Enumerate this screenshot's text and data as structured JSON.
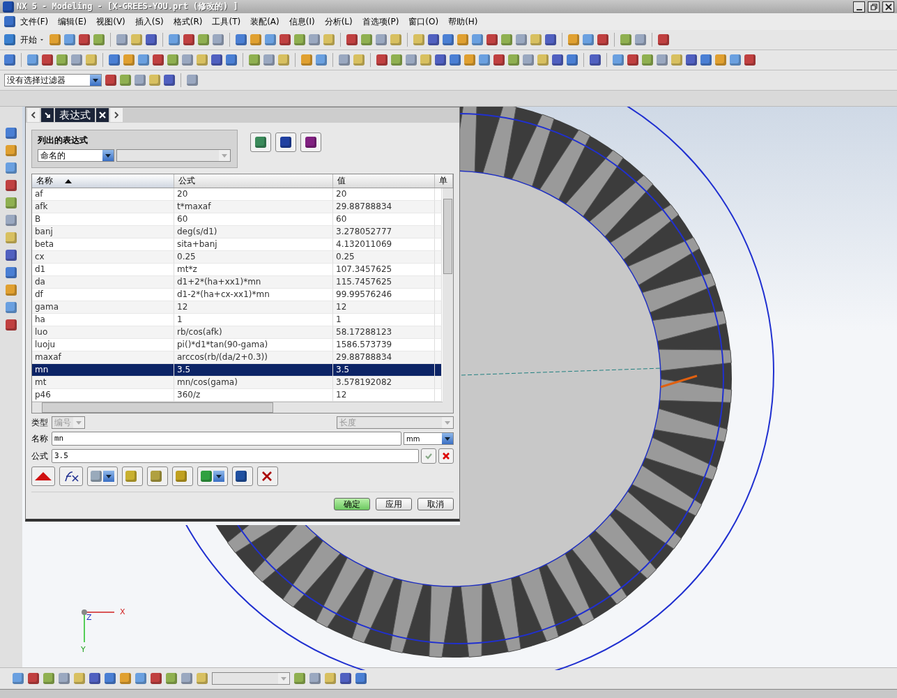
{
  "window": {
    "title": "NX 5 - Modeling - [X-GREES-YOU.prt (修改的) ]"
  },
  "menu": [
    "文件(F)",
    "编辑(E)",
    "视图(V)",
    "插入(S)",
    "格式(R)",
    "工具(T)",
    "装配(A)",
    "信息(I)",
    "分析(L)",
    "首选项(P)",
    "窗口(O)",
    "帮助(H)"
  ],
  "toolbar": {
    "start_button": "开始"
  },
  "selection_filter": {
    "value": "没有选择过滤器"
  },
  "dialog": {
    "title": "表达式",
    "listed_group": {
      "label": "列出的表达式",
      "filter": "命名的"
    },
    "table": {
      "columns": [
        {
          "label": "名称",
          "sorted": true
        },
        {
          "label": "公式",
          "sorted": false
        },
        {
          "label": "值",
          "sorted": false
        },
        {
          "label": "单",
          "sorted": false
        }
      ],
      "rows": [
        {
          "name": "af",
          "formula": "20",
          "value": "20",
          "selected": false
        },
        {
          "name": "afk",
          "formula": "t*maxaf",
          "value": "29.88788834",
          "selected": false
        },
        {
          "name": "B",
          "formula": "60",
          "value": "60",
          "selected": false
        },
        {
          "name": "banj",
          "formula": "deg(s/d1)",
          "value": "3.278052777",
          "selected": false
        },
        {
          "name": "beta",
          "formula": "sita+banj",
          "value": "4.132011069",
          "selected": false
        },
        {
          "name": "cx",
          "formula": "0.25",
          "value": "0.25",
          "selected": false
        },
        {
          "name": "d1",
          "formula": "mt*z",
          "value": "107.3457625",
          "selected": false
        },
        {
          "name": "da",
          "formula": "d1+2*(ha+xx1)*mn",
          "value": "115.7457625",
          "selected": false
        },
        {
          "name": "df",
          "formula": "d1-2*(ha+cx-xx1)*mn",
          "value": "99.99576246",
          "selected": false
        },
        {
          "name": "gama",
          "formula": "12",
          "value": "12",
          "selected": false
        },
        {
          "name": "ha",
          "formula": "1",
          "value": "1",
          "selected": false
        },
        {
          "name": "luo",
          "formula": "rb/cos(afk)",
          "value": "58.17288123",
          "selected": false
        },
        {
          "name": "luoju",
          "formula": "pi()*d1*tan(90-gama)",
          "value": "1586.573739",
          "selected": false
        },
        {
          "name": "maxaf",
          "formula": "arccos(rb/(da/2+0.3))",
          "value": "29.88788834",
          "selected": false
        },
        {
          "name": "mn",
          "formula": "3.5",
          "value": "3.5",
          "selected": true
        },
        {
          "name": "mt",
          "formula": "mn/cos(gama)",
          "value": "3.578192082",
          "selected": false
        },
        {
          "name": "p46",
          "formula": "360/z",
          "value": "12",
          "selected": false
        }
      ]
    },
    "form": {
      "type_label": "类型",
      "type_value": "编号",
      "type_disabled": true,
      "dimension_value": "长度",
      "dimension_disabled": true,
      "name_label": "名称",
      "name_value": "mn",
      "unit": "mm",
      "formula_label": "公式",
      "formula_value": "3.5"
    },
    "buttons": [
      {
        "label": "确定",
        "default": true
      },
      {
        "label": "应用",
        "default": false
      },
      {
        "label": "取消",
        "default": false
      }
    ]
  },
  "axes": {
    "x": "X",
    "y": "Y",
    "z": "Z"
  }
}
